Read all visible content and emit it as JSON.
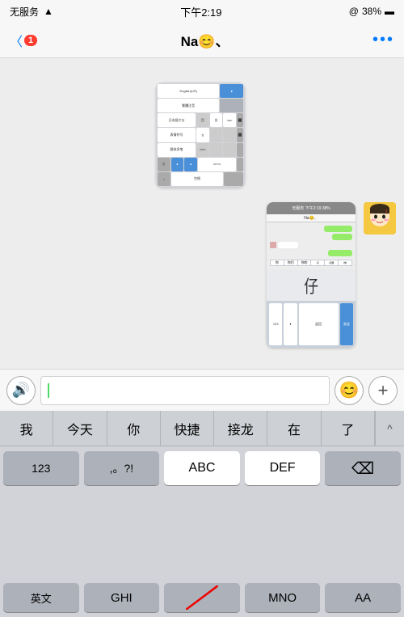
{
  "statusBar": {
    "carrier": "无服务",
    "wifi": "WiFi",
    "time": "下午2:19",
    "location": "@",
    "battery": "38%"
  },
  "navBar": {
    "backLabel": "〈",
    "badge": "1",
    "title": "Na😊、",
    "more": "•••"
  },
  "chat": {
    "messages": [
      {
        "type": "screenshot",
        "index": 1
      },
      {
        "type": "screenshot_with_avatar",
        "index": 2
      }
    ]
  },
  "inputBar": {
    "voiceIcon": "🔊",
    "placeholder": "",
    "emojiIcon": "😊",
    "addIcon": "+"
  },
  "keyboard": {
    "predictive": [
      "我",
      "今天",
      "你",
      "快捷",
      "接龙",
      "在",
      "了"
    ],
    "row1": [
      "A B C",
      "D E F"
    ],
    "numberKey": "123",
    "symbolKey": ",。?!",
    "abcKey": "ABC",
    "defKey": "DEF",
    "ghiKey": "GHI",
    "mnoKey": "MNO",
    "aaKey": "AA",
    "yingwenKey": "英文"
  }
}
